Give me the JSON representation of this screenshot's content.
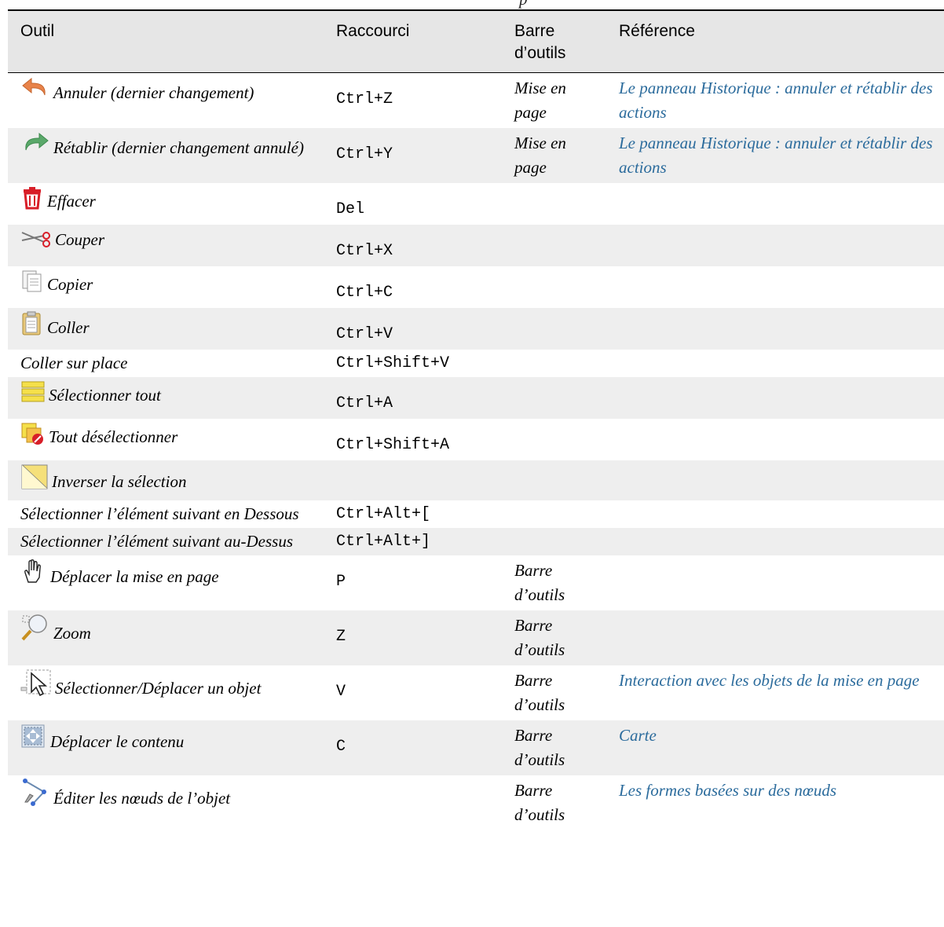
{
  "page_caption": "p",
  "headers": {
    "tool": "Outil",
    "shortcut": "Raccourci",
    "toolbar": "Barre d’outils",
    "reference": "Référence"
  },
  "rows": [
    {
      "icon": "undo-icon",
      "tool": "Annuler (dernier changement)",
      "shortcut": "Ctrl+Z",
      "toolbar": "Mise en page",
      "reference": "Le panneau Historique : annuler et rétablir des actions"
    },
    {
      "icon": "redo-icon",
      "tool": "Rétablir (dernier changement annulé)",
      "shortcut": "Ctrl+Y",
      "toolbar": "Mise en page",
      "reference": "Le panneau Historique : annuler et rétablir des actions"
    },
    {
      "icon": "trash-icon",
      "tool": "Effacer",
      "shortcut": "Del",
      "toolbar": "",
      "reference": ""
    },
    {
      "icon": "scissors-icon",
      "tool": "Couper",
      "shortcut": "Ctrl+X",
      "toolbar": "",
      "reference": ""
    },
    {
      "icon": "copy-icon",
      "tool": "Copier",
      "shortcut": "Ctrl+C",
      "toolbar": "",
      "reference": ""
    },
    {
      "icon": "paste-icon",
      "tool": "Coller",
      "shortcut": "Ctrl+V",
      "toolbar": "",
      "reference": ""
    },
    {
      "icon": "",
      "tool": "Coller sur place",
      "shortcut": "Ctrl+Shift+V",
      "toolbar": "",
      "reference": ""
    },
    {
      "icon": "select-all-icon",
      "tool": "Sélectionner tout",
      "shortcut": "Ctrl+A",
      "toolbar": "",
      "reference": ""
    },
    {
      "icon": "deselect-all-icon",
      "tool": "Tout désélectionner",
      "shortcut": "Ctrl+Shift+A",
      "toolbar": "",
      "reference": ""
    },
    {
      "icon": "invert-selection-icon",
      "tool": "Inverser la sélection",
      "shortcut": "",
      "toolbar": "",
      "reference": ""
    },
    {
      "icon": "",
      "tool": "Sélectionner l’élément suivant en Dessous",
      "shortcut": "Ctrl+Alt+[",
      "toolbar": "",
      "reference": ""
    },
    {
      "icon": "",
      "tool": "Sélectionner l’élément suivant au-Dessus",
      "shortcut": "Ctrl+Alt+]",
      "toolbar": "",
      "reference": ""
    },
    {
      "icon": "pan-hand-icon",
      "tool": "Déplacer la mise en page",
      "shortcut": "P",
      "toolbar": "Barre d’outils",
      "reference": ""
    },
    {
      "icon": "zoom-icon",
      "tool": "Zoom",
      "shortcut": "Z",
      "toolbar": "Barre d’outils",
      "reference": ""
    },
    {
      "icon": "select-move-icon",
      "tool": "Sélectionner/Déplacer un objet",
      "shortcut": "V",
      "toolbar": "Barre d’outils",
      "reference": "Interaction avec les objets de la mise en page"
    },
    {
      "icon": "move-content-icon",
      "tool": "Déplacer le contenu",
      "shortcut": "C",
      "toolbar": "Barre d’outils",
      "reference": "Carte"
    },
    {
      "icon": "edit-nodes-icon",
      "tool": "Éditer les nœuds de l’objet",
      "shortcut": "",
      "toolbar": "Barre d’outils",
      "reference": "Les formes basées sur des nœuds"
    }
  ]
}
